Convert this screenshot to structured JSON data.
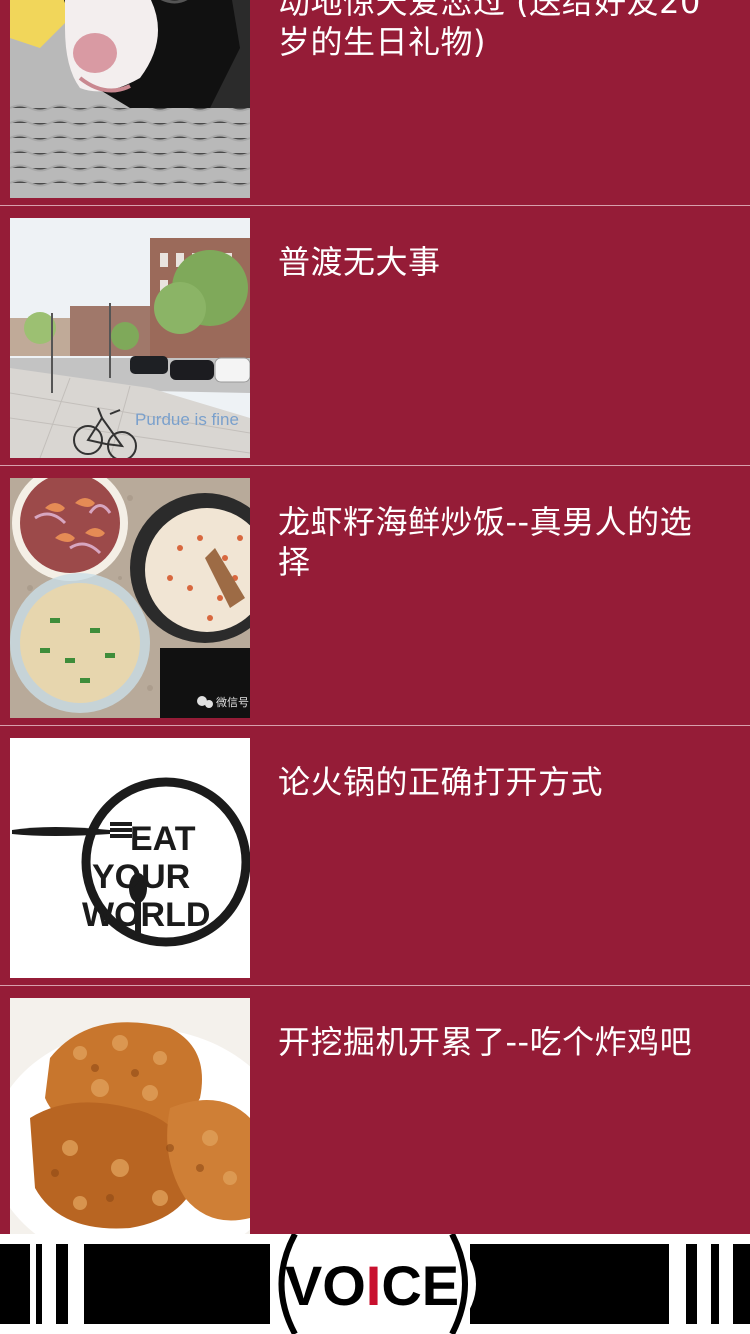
{
  "articles": [
    {
      "title": "动地惊天爱恋过 (送给好友20岁的生日礼物)",
      "image": "sleeping-dog-photo"
    },
    {
      "title": "普渡无大事",
      "image": "purdue-street-photo",
      "image_caption": "Purdue is fine"
    },
    {
      "title": "龙虾籽海鲜炒饭--真男人的选择",
      "image": "seafood-fried-rice-photo",
      "image_watermark": "微信号"
    },
    {
      "title": "论火锅的正确打开方式",
      "image": "eat-your-world-logo",
      "logo_line1": "EAT",
      "logo_line2": "YOUR",
      "logo_line3": "WORLD"
    },
    {
      "title": "开挖掘机开累了--吃个炸鸡吧",
      "image": "fried-chicken-photo"
    }
  ],
  "footer": {
    "logo_text_part1": "VO",
    "logo_text_accent": "I",
    "logo_text_part2": "CE",
    "accent_color": "#c8102e",
    "bar_color": "#000000"
  },
  "colors": {
    "background": "#951c37",
    "divider": "#d7a0ac",
    "title_text": "#ffffff"
  }
}
